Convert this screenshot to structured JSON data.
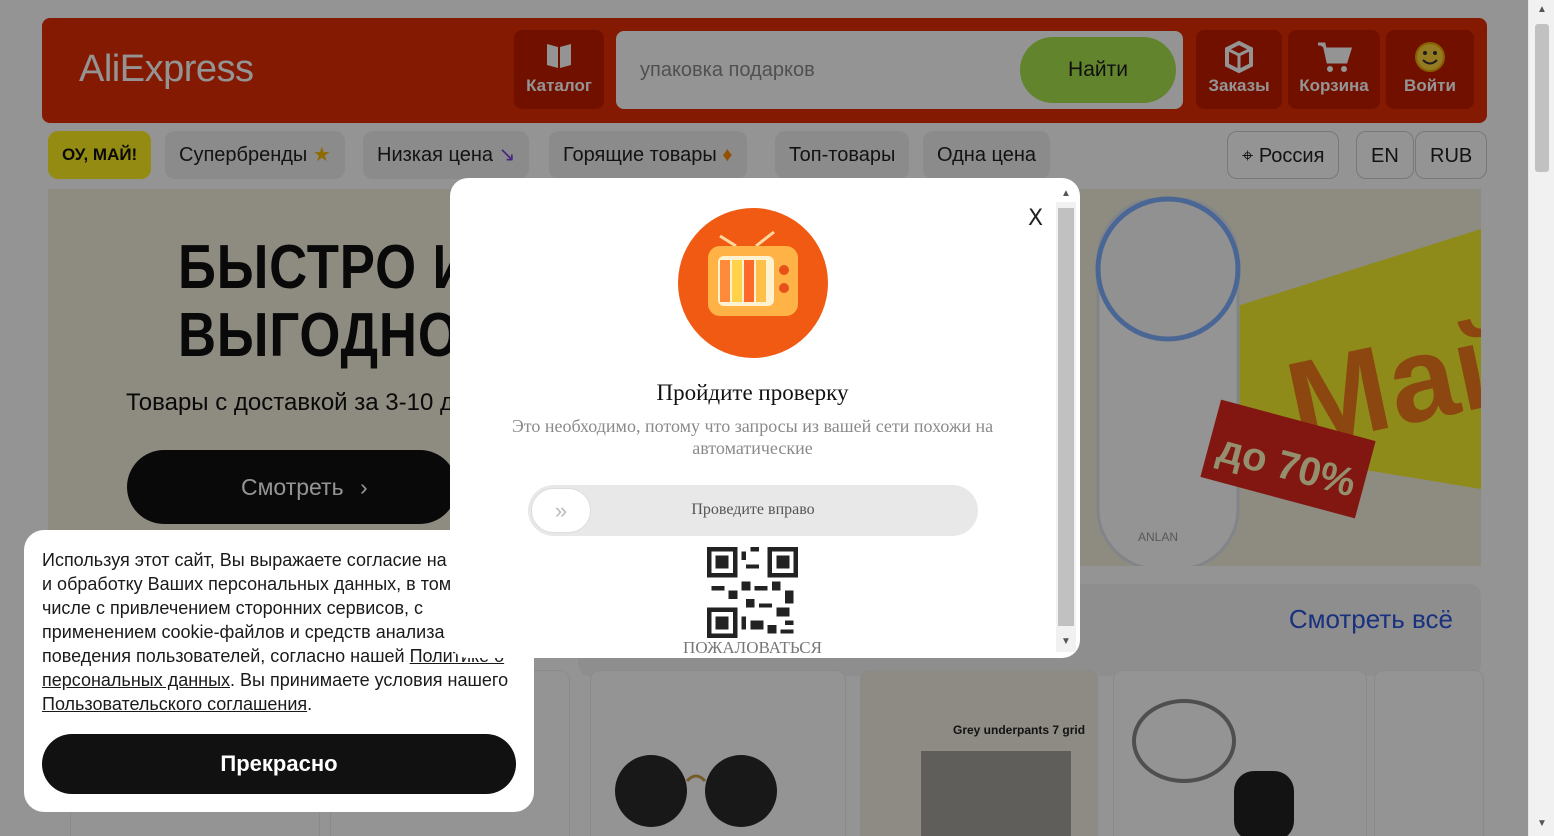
{
  "header": {
    "logo": "AliExpress",
    "catalog_label": "Каталог",
    "search_placeholder": "упаковка подарков",
    "find_label": "Найти",
    "orders_label": "Заказы",
    "cart_label": "Корзина",
    "login_label": "Войти"
  },
  "nav": {
    "chips": [
      {
        "label": "ОУ, МАЙ!"
      },
      {
        "label": "Супербренды"
      },
      {
        "label": "Низкая цена"
      },
      {
        "label": "Горящие товары"
      },
      {
        "label": "Топ-товары"
      },
      {
        "label": "Одна цена"
      }
    ],
    "region": "Россия",
    "language": "EN",
    "currency": "RUB"
  },
  "banner": {
    "headline_line1": "БЫСТРО И",
    "headline_line2": "ВЫГОДНО",
    "subtitle": "Товары с доставкой за 3-10 д",
    "button_label": "Смотреть",
    "promo_text": "Май!",
    "promo_discount": "до 70%",
    "product_brand": "ANLAN"
  },
  "section": {
    "see_all": "Смотреть всё",
    "card_caption": "Grey underpants  7 grid"
  },
  "cookie": {
    "text_part1": "Используя этот сайт, Вы выражаете согласие на",
    "text_part2": "и обработку Ваших персональных данных, в том",
    "text_part3": "числе с привлечением сторонних сервисов, с",
    "text_part4": "применением cookie-файлов и средств анализа",
    "text_part5": "поведения пользователей, согласно нашей ",
    "policy_link": "Политике о персональных данных",
    "text_part6": ". Вы принимаете условия нашего ",
    "agreement_link": "Пользовательского соглашения",
    "text_part7": ".",
    "button_label": "Прекрасно"
  },
  "captcha": {
    "close": "X",
    "title": "Пройдите проверку",
    "subtitle": "Это необходимо, потому что запросы из вашей сети похожи на автоматические",
    "slider_label": "Проведите вправо",
    "knob_icon": "double-chevron-right-icon",
    "report_label": "ПОЖАЛОВАТЬСЯ"
  },
  "colors": {
    "brand_red": "#e62e04",
    "find_green": "#a8e34d",
    "link_blue": "#2b55d9",
    "promo_yellow": "#fff21f"
  }
}
